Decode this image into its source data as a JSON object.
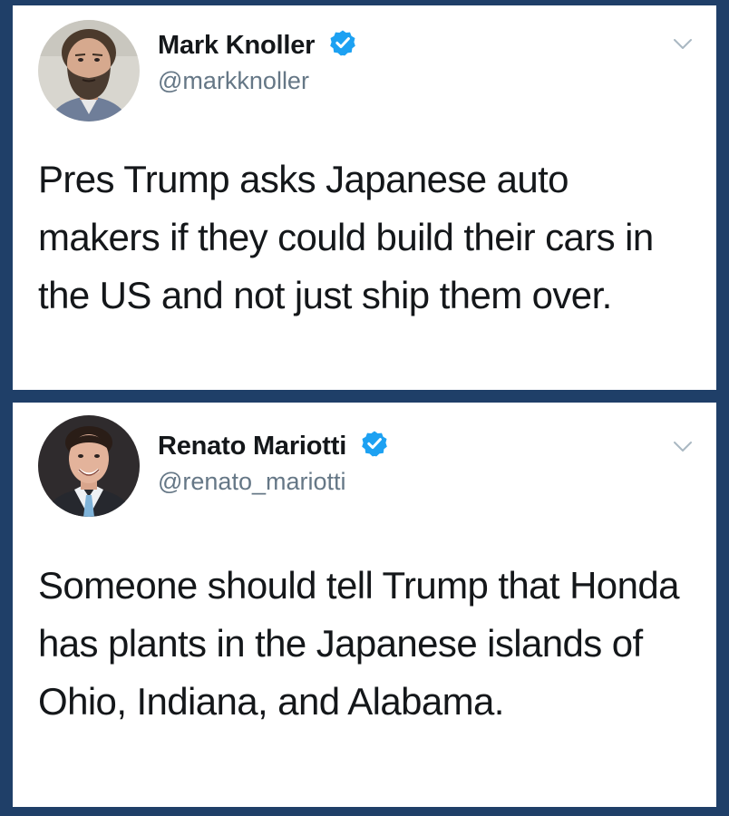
{
  "tweets": [
    {
      "display_name": "Mark Knoller",
      "handle": "@markknoller",
      "verified": true,
      "avatar_icon": "person-photo-bearded-man",
      "menu_icon": "chevron-down-icon",
      "text": "Pres Trump asks Japanese auto makers if they could build their cars in the US and not just ship them over."
    },
    {
      "display_name": "Renato Mariotti",
      "handle": "@renato_mariotti",
      "verified": true,
      "avatar_icon": "person-photo-man-in-suit",
      "menu_icon": "chevron-down-icon",
      "text": "Someone should tell Trump that Honda has plants in the Japanese islands of Ohio, Indiana, and Alabama."
    }
  ],
  "colors": {
    "background": "#1f3f68",
    "card": "#ffffff",
    "verified_badge": "#1da1f2",
    "text": "#14171a",
    "handle": "#657786"
  }
}
